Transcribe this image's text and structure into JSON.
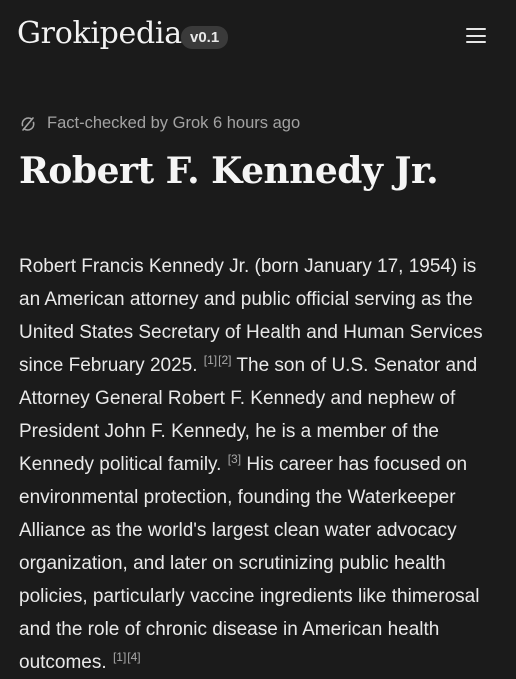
{
  "header": {
    "logo": "Grokipedia",
    "version": "v0.1",
    "menu_icon": "hamburger-menu-icon"
  },
  "meta": {
    "fact_check": "Fact-checked by Grok 6 hours ago",
    "fact_check_icon": "refresh-slash-icon"
  },
  "article": {
    "title": "Robert F. Kennedy Jr.",
    "segments": [
      "Robert Francis Kennedy Jr. (born January 17, 1954) is an American attorney and public official serving as the United States Secretary of Health and Human Services since February 2025.",
      " The son of U.S. Senator and Attorney General Robert F. Kennedy and nephew of President John F. Kennedy, he is a member of the Kennedy political family.",
      " His career has focused on environmental protection, founding the Waterkeeper Alliance as the world's largest clean water advocacy organization, and later on scrutinizing public health policies, particularly vaccine ingredients like thimerosal and the role of chronic disease in American health outcomes."
    ],
    "refs": [
      "[1]",
      "[2]",
      "[3]",
      "[1]",
      "[4]"
    ]
  }
}
